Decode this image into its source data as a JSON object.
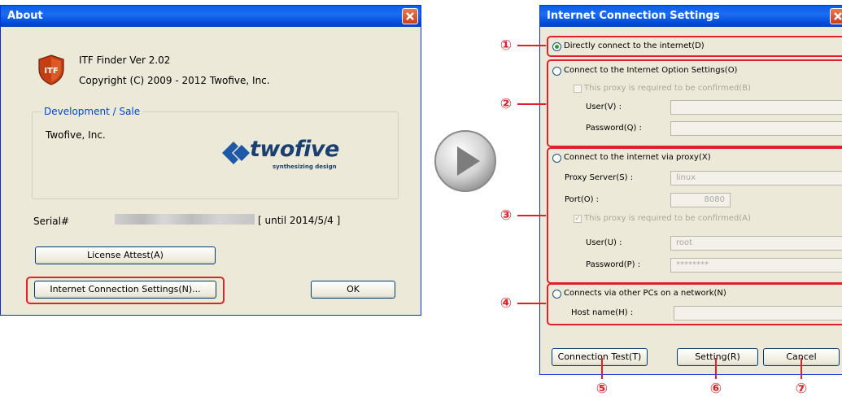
{
  "about": {
    "title": "About",
    "app_name": "ITF Finder  Ver 2.02",
    "copyright": "Copyright (C) 2009 - 2012 Twofive, Inc.",
    "group_label": "Development / Sale",
    "company": "Twofive, Inc.",
    "logo_word": "twofive",
    "logo_tagline": "synthesizing design",
    "serial_label": "Serial#",
    "serial_until": "[ until 2014/5/4 ]",
    "license_button": "License Attest(A)",
    "connection_button": "Internet Connection Settings(N)...",
    "ok_button": "OK",
    "icon_text": "ITF"
  },
  "settings": {
    "title": "Internet Connection Settings",
    "direct_option": "Directly connect to the internet(D)",
    "ie_option": "Connect to the Internet Option Settings(O)",
    "ie_confirm": "This proxy is required to be confirmed(B)",
    "ie_user_label": "User(V) :",
    "ie_password_label": "Password(Q) :",
    "proxy_option": "Connect to the internet via proxy(X)",
    "proxy_server_label": "Proxy Server(S) :",
    "proxy_server_value": "linux",
    "port_label": "Port(O) :",
    "port_value": "8080",
    "proxy_confirm": "This proxy is required to be confirmed(A)",
    "proxy_user_label": "User(U) :",
    "proxy_user_value": "root",
    "proxy_password_label": "Password(P) :",
    "proxy_password_value": "********",
    "other_pc_option": "Connects via other PCs on a network(N)",
    "host_label": "Host name(H) :",
    "test_button": "Connection Test(T)",
    "setting_button": "Setting(R)",
    "cancel_button": "Cancel"
  },
  "callouts": [
    "①",
    "②",
    "③",
    "④",
    "⑤",
    "⑥",
    "⑦"
  ],
  "colors": {
    "accent_red": "#e0202a",
    "titlebar_blue": "#0a5ee8",
    "dialog_bg": "#ece9d8"
  }
}
